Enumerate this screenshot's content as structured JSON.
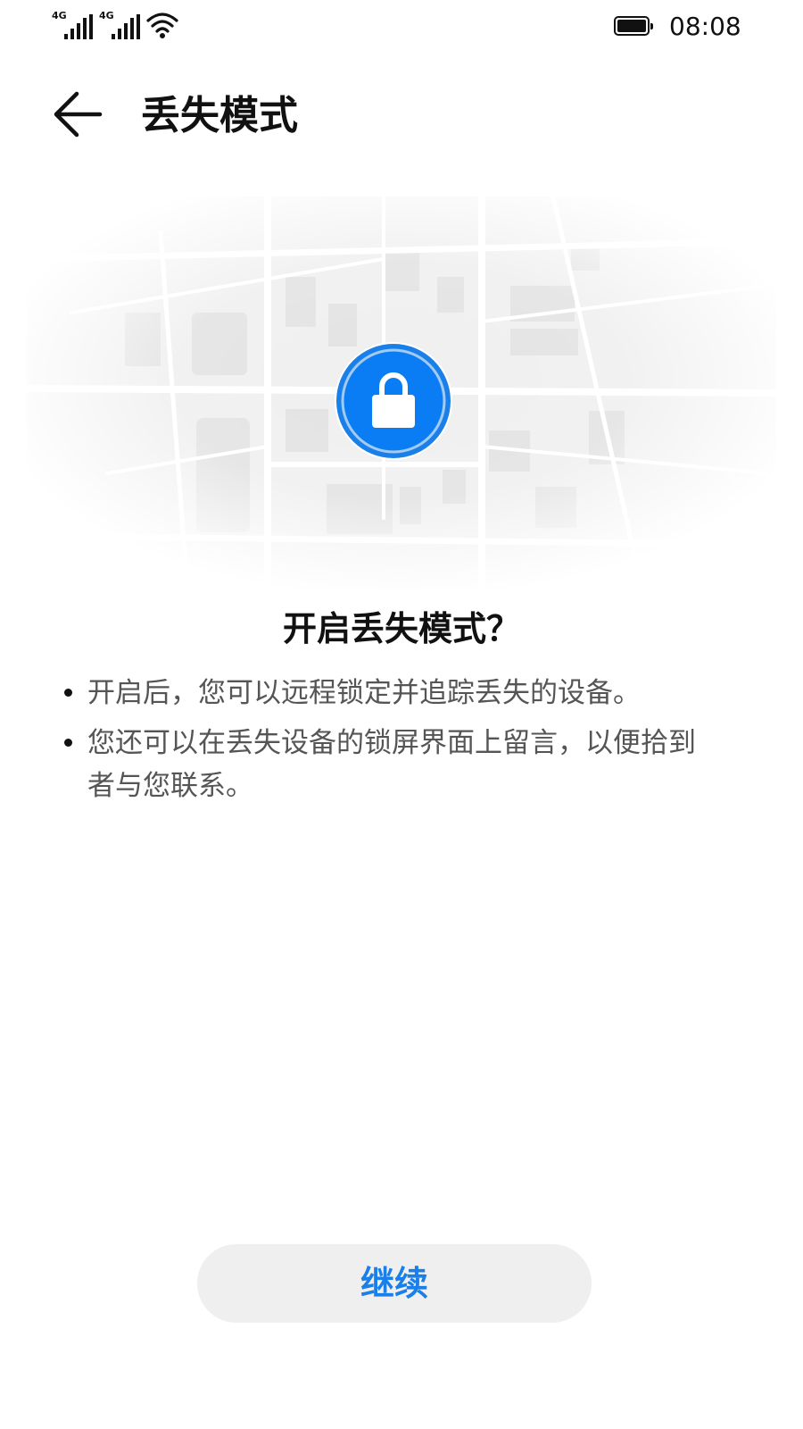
{
  "status_bar": {
    "network_1": "4G",
    "network_2": "4G",
    "time": "08:08",
    "signal_icon": "signal-bars-icon",
    "wifi_icon": "wifi-icon",
    "battery_icon": "battery-icon",
    "battery_level": 1.0
  },
  "header": {
    "back_icon": "arrow-left-icon",
    "title": "丢失模式"
  },
  "illustration": {
    "background": "map-illustration",
    "badge_icon": "lock-icon",
    "badge_color": "#0a7cf4"
  },
  "dialog": {
    "title": "开启丢失模式？",
    "bullets": [
      "开启后，您可以远程锁定并追踪丢失的设备。",
      "您还可以在丢失设备的锁屏界面上留言，以便拾到者与您联系。"
    ]
  },
  "actions": {
    "continue_label": "继续",
    "accent_color": "#1a7fe8"
  }
}
